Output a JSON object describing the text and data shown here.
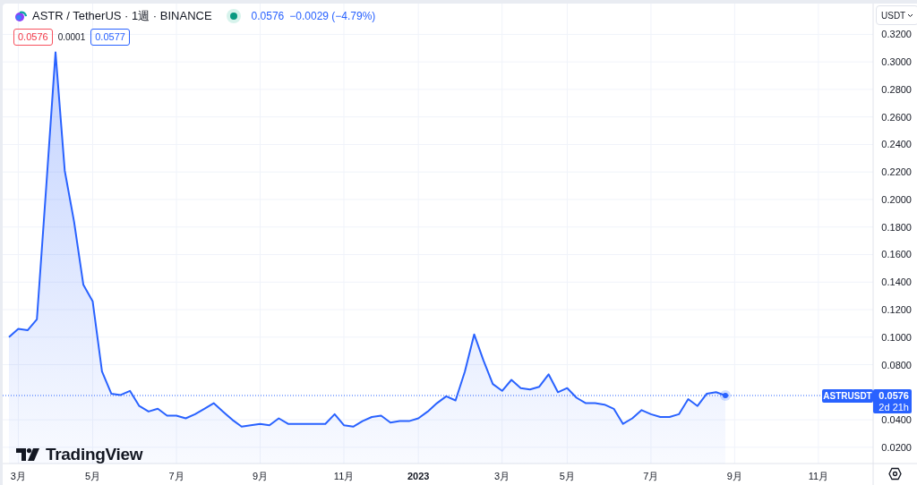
{
  "header": {
    "symbol": "ASTR / TetherUS · 1週 · BINANCE",
    "market_open": true,
    "price": "0.0576",
    "change": "−0.0029 (−4.79%)"
  },
  "quote": {
    "bid": "0.0576",
    "spread": "0.0001",
    "ask": "0.0577"
  },
  "currency_button": "USDT",
  "chart": {
    "chart_data": {
      "type": "area",
      "categories": [
        null,
        "3月",
        null,
        null,
        null,
        null,
        null,
        null,
        null,
        "5月",
        null,
        null,
        null,
        null,
        null,
        null,
        null,
        null,
        "7月",
        null,
        null,
        null,
        null,
        null,
        null,
        null,
        null,
        "9月",
        null,
        null,
        null,
        null,
        null,
        null,
        null,
        null,
        "11月",
        null,
        null,
        null,
        null,
        null,
        null,
        null,
        "2023",
        null,
        null,
        null,
        null,
        null,
        null,
        null,
        null,
        "3月",
        null,
        null,
        null,
        null,
        null,
        null,
        "5月",
        null,
        null,
        null,
        null,
        null,
        null,
        null,
        null,
        "7月",
        null,
        null,
        null,
        null,
        null,
        null,
        null,
        null,
        "9月",
        null,
        null,
        null,
        null,
        null,
        null,
        null,
        null,
        "11月",
        null,
        null,
        null,
        null,
        null
      ],
      "series": [
        {
          "name": "ASTRUSDT",
          "color": "#2962ff",
          "values": [
            0.1,
            0.106,
            0.105,
            0.113,
            0.209,
            0.307,
            0.221,
            0.184,
            0.138,
            0.126,
            0.075,
            0.059,
            0.058,
            0.061,
            0.05,
            0.046,
            0.048,
            0.043,
            0.043,
            0.041,
            0.044,
            0.048,
            0.052,
            0.046,
            0.04,
            0.035,
            0.036,
            0.037,
            0.036,
            0.041,
            0.037,
            0.037,
            0.037,
            0.037,
            0.037,
            0.044,
            0.036,
            0.035,
            0.039,
            0.042,
            0.043,
            0.038,
            0.039,
            0.039,
            0.041,
            0.046,
            0.052,
            0.057,
            0.054,
            0.075,
            0.102,
            0.083,
            0.066,
            0.061,
            0.069,
            0.063,
            0.062,
            0.064,
            0.073,
            0.06,
            0.063,
            0.056,
            0.052,
            0.052,
            0.051,
            0.048,
            0.037,
            0.041,
            0.047,
            0.044,
            0.042,
            0.042,
            0.044,
            0.055,
            0.05,
            0.059,
            0.06,
            0.0576,
            null,
            null,
            null,
            null,
            null,
            null,
            null,
            null,
            null,
            null,
            null,
            null,
            null,
            null,
            null
          ]
        }
      ],
      "ylim": [
        0.0082,
        0.3417
      ],
      "grid": true,
      "yticks": [
        {
          "value": 0.32,
          "label": "0.3200"
        },
        {
          "value": 0.3,
          "label": "0.3000"
        },
        {
          "value": 0.28,
          "label": "0.2800"
        },
        {
          "value": 0.26,
          "label": "0.2600"
        },
        {
          "value": 0.24,
          "label": "0.2400"
        },
        {
          "value": 0.22,
          "label": "0.2200"
        },
        {
          "value": 0.2,
          "label": "0.2000"
        },
        {
          "value": 0.18,
          "label": "0.1800"
        },
        {
          "value": 0.16,
          "label": "0.1600"
        },
        {
          "value": 0.14,
          "label": "0.1400"
        },
        {
          "value": 0.12,
          "label": "0.1200"
        },
        {
          "value": 0.1,
          "label": "0.1000"
        },
        {
          "value": 0.08,
          "label": "0.0800"
        },
        {
          "value": 0.04,
          "label": "0.0400"
        },
        {
          "value": 0.02,
          "label": "0.0200"
        }
      ]
    },
    "last_price_label": {
      "price": "0.0576",
      "countdown": "2d 21h"
    }
  },
  "watermark_logo": "TradingView"
}
